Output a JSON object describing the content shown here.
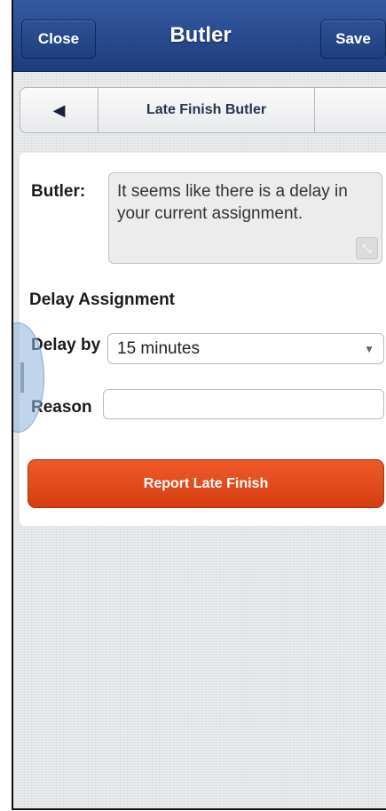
{
  "header": {
    "close_label": "Close",
    "title": "Butler",
    "save_label": "Save"
  },
  "nav": {
    "back_icon": "◀",
    "title": "Late Finish Butler"
  },
  "form": {
    "butler_label": "Butler:",
    "butler_message": "It seems like there is a delay in your current assignment.",
    "section_heading": "Delay Assignment",
    "delay_label": "Delay by",
    "delay_value": "15 minutes",
    "reason_label": "Reason",
    "reason_value": "",
    "submit_label": "Report Late Finish"
  },
  "icons": {
    "back": "back-arrow-icon",
    "expand": "expand-icon",
    "dropdown": "chevron-down-icon",
    "drawer": "drawer-handle-icon"
  },
  "colors": {
    "header": "#2a4b8e",
    "accent_button": "#e24b1f"
  }
}
